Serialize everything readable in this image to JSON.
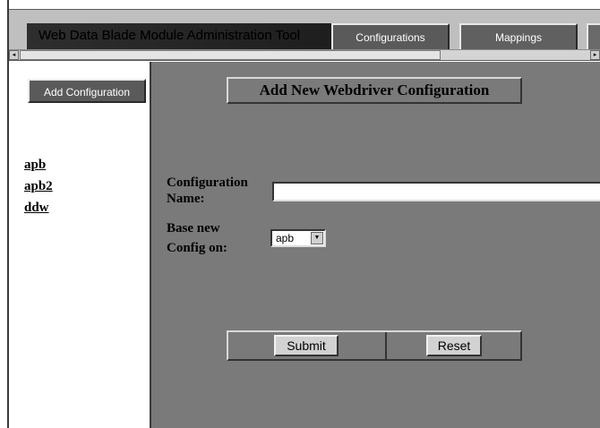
{
  "header": {
    "title": "Web Data Blade Module Administration Tool",
    "tabs": [
      {
        "label": "Configurations"
      },
      {
        "label": "Mappings"
      }
    ]
  },
  "sidebar": {
    "add_button_label": "Add Configuration",
    "links": [
      "apb",
      "apb2",
      "ddw"
    ]
  },
  "main": {
    "page_title": "Add New Webdriver Configuration",
    "config_name_label_1": "Configuration",
    "config_name_label_2": "Name:",
    "config_name_value": "",
    "base_label_1": "Base new",
    "base_label_2": "Config on:",
    "base_selected": "apb",
    "submit_label": "Submit",
    "reset_label": "Reset"
  },
  "colors": {
    "content_bg": "#7a7a7a",
    "tab_bg": "#5a5a5a",
    "header_bg": "#bfbfbf"
  }
}
